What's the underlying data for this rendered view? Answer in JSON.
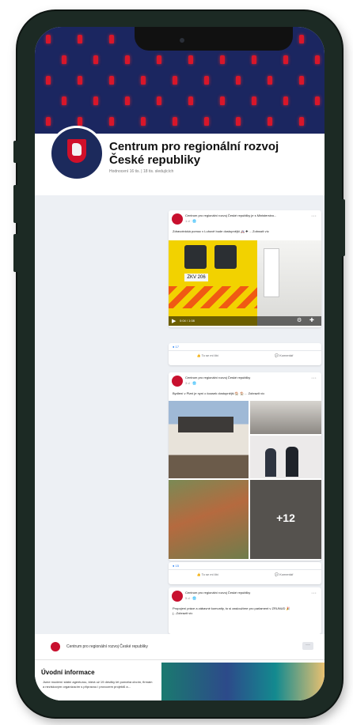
{
  "page": {
    "name": "Centrum pro regionální rozvoj České republiky",
    "meta": "Hodnocení 16 tis. | 18 tis. sledujících"
  },
  "posts": [
    {
      "author": "Centrum pro regionální rozvoj České republiky je s Ministerstvo...",
      "time": "1 d · 🌐",
      "text": "Zdravotnická pomoc v Luhově bude dostupnější 🚑 ✚ ... Zobrazit víc",
      "video_time": "0:04 / 1:08",
      "reactions": "17",
      "like": "To se mi líbí",
      "comment": "Komentář"
    },
    {
      "author": "Centrum pro regionální rozvoj České republiky",
      "time": "3 d · 🌐",
      "text": "Bydlení v Plzni je nyní o kousek dostupnější 🏠 🏠 ... Zobrazit víc",
      "more_count": "+12",
      "reactions": "15",
      "like": "To se mi líbí",
      "comment": "Komentář"
    },
    {
      "author": "Centrum pro regionální rozvoj České republiky",
      "time": "5 d · 🌐",
      "text": "Propojení práce a zábavné komunity, to si zasloužíme pro parlament v ZRUNUD 🎉",
      "more": "(...Zobrazit víc"
    }
  ],
  "bottom": {
    "name": "Centrum pro regionální rozvoj České republiky",
    "dots": "···",
    "intro_title": "Úvodní informace",
    "intro_text": "Jsme moderní státní agenturou, která už 19 desítky let pomáhá obcím, firmám a neziskovým organizacím s přípravou i provozem projektů a..."
  },
  "colors": {
    "brand": "#c8102e",
    "cover": "#1b2660",
    "fb_blue": "#1877f2"
  }
}
